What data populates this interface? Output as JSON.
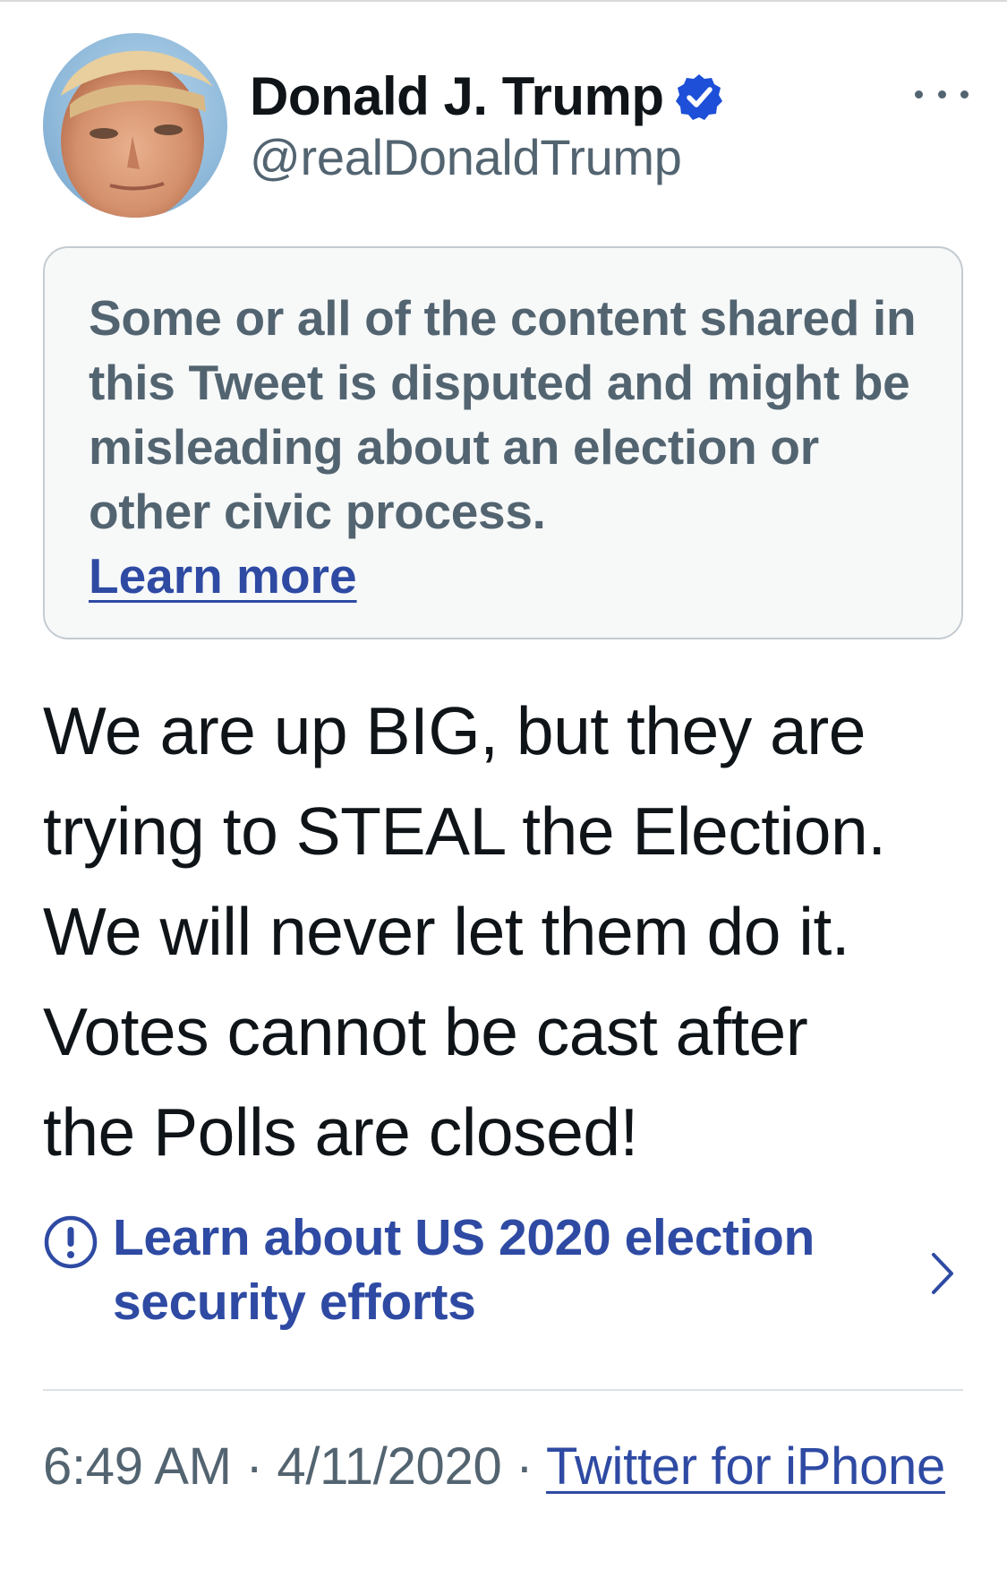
{
  "tweet": {
    "author": {
      "display_name": "Donald J. Trump",
      "handle": "@realDonaldTrump",
      "verified": true
    },
    "notice": {
      "text": "Some or all of the content shared in this Tweet is disputed and might be misleading about an election or other civic process.",
      "link_label": "Learn more"
    },
    "text_lines": [
      "We are up BIG, but they are",
      "trying to STEAL the Election.",
      "We will never let them do it.",
      "Votes cannot be cast after",
      "the Polls are closed!"
    ],
    "election_prompt": {
      "line1": "Learn about US 2020 election",
      "line2": "security efforts"
    },
    "meta": {
      "time": "6:49 AM",
      "separator": "·",
      "date": "4/11/2020",
      "source": "Twitter for iPhone"
    }
  },
  "colors": {
    "link_blue": "#2e4aa3",
    "verified_blue": "#1d4fd8",
    "muted_text": "#536471",
    "notice_bg": "#f7f9f9"
  },
  "icons": {
    "verified": "verified-badge-icon",
    "more": "more-horizontal-icon",
    "alert": "exclamation-circle-icon",
    "chevron": "chevron-right-icon"
  }
}
